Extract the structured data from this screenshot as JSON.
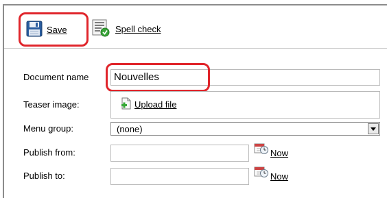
{
  "toolbar": {
    "save_label": "Save",
    "spell_check_label": "Spell check",
    "save_icon": "floppy-disk-icon",
    "spell_check_icon": "spell-check-icon"
  },
  "form": {
    "document_name": {
      "label": "Document name",
      "value": "Nouvelles"
    },
    "teaser_image": {
      "label": "Teaser image:",
      "upload_label": "Upload file",
      "upload_icon": "upload-file-icon"
    },
    "menu_group": {
      "label": "Menu group:",
      "selected": "(none)"
    },
    "publish_from": {
      "label": "Publish from:",
      "value": "",
      "now_label": "Now",
      "calendar_icon": "calendar-clock-icon"
    },
    "publish_to": {
      "label": "Publish to:",
      "value": "",
      "now_label": "Now",
      "calendar_icon": "calendar-clock-icon"
    }
  },
  "colors": {
    "highlight": "#e0252b",
    "border": "#b9b9b9"
  }
}
